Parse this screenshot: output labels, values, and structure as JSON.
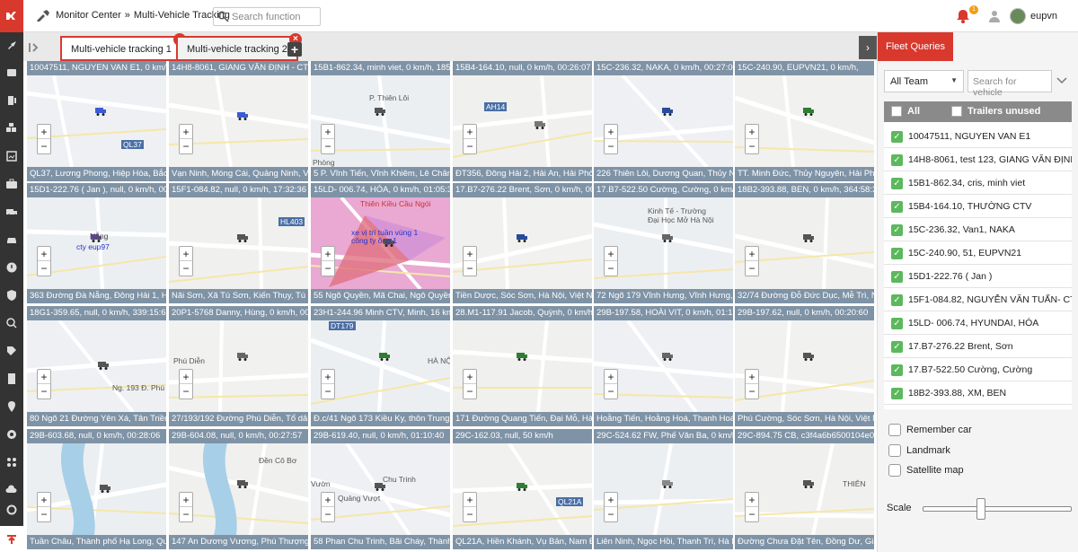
{
  "header": {
    "breadcrumb_root": "Monitor Center",
    "breadcrumb_sep": "»",
    "breadcrumb_page": "Multi-Vehicle Tracking",
    "search_placeholder": "Search function",
    "notification_count": "1",
    "username": "eupvn",
    "accent_color": "#d9382d"
  },
  "tabs": [
    {
      "label": "Multi-vehicle tracking 1"
    },
    {
      "label": "Multi-vehicle tracking 2"
    }
  ],
  "cells": [
    {
      "info": "10047511, NGUYEN VAN E1, 0 km/h, 1",
      "addr": "QL37, Lương Phong, Hiệp Hòa, Bắc Gia"
    },
    {
      "info": "14H8-8061, GIANG VĂN ĐỊNH - CTV Hi",
      "addr": "Vạn Ninh, Móng Cái, Quảng Ninh, Việt N"
    },
    {
      "info": "15B1-862.34, minh viet, 0 km/h, 1852:49",
      "addr": "5 P. Vĩnh Tiến, Vĩnh Khiêm, Lê Chân, Hả"
    },
    {
      "info": "15B4-164.10, null, 0 km/h, 00:26:07",
      "addr": "ĐT356, Đông Hải 2, Hải An, Hải Phòng,"
    },
    {
      "info": "15C-236.32, NAKA, 0 km/h, 00:27:00",
      "addr": "226 Thiên Lôi, Dương Quan, Thủy Nguy"
    },
    {
      "info": "15C-240.90, EUPVN21, 0 km/h,",
      "addr": "TT. Minh Đức, Thủy Nguyên, Hải Phòng"
    },
    {
      "info": "15D1-222.76 ( Jan ), null, 0 km/h, 00:43",
      "addr": "363 Đường Đà Nẵng, Đông Hải 1, Hải A"
    },
    {
      "info": "15F1-084.82, null, 0 km/h, 17:32:36",
      "addr": "Nãi Sơn, Xã Tú Sơn, Kiến Thụy, Tú Sơn"
    },
    {
      "info": "15LD- 006.74, HÓA, 0 km/h, 01:05:30",
      "addr": "55 Ngõ Quyền, Mã Chai, Ngô Quyền, Hả"
    },
    {
      "info": "17.B7-276.22 Brent, Sơn, 0 km/h, 00:30",
      "addr": "Tiền Dược, Sóc Sơn, Hà Nội, Việt Nam"
    },
    {
      "info": "17.B7-522.50 Cường, Cường, 0 km/h,",
      "addr": "72 Ngõ 179 Vĩnh Hưng, Vĩnh Hưng, Ho"
    },
    {
      "info": "18B2-393.88, BEN, 0 km/h, 364:58:39",
      "addr": "32/74 Đường Đỗ Đức Dục, Mễ Trì, Nam"
    },
    {
      "info": "18G1-359.65, null, 0 km/h, 339:15:60",
      "addr": "80 Ngõ 21 Đường Yên Xá, Tân Triều, Th"
    },
    {
      "info": "20P1-5768 Danny, Hùng, 0 km/h, 00:58",
      "addr": "27/193/192 Đường Phú Diễn, Tổ dân phố"
    },
    {
      "info": "23H1-244.96 Minh CTV, Minh, 16 km/h",
      "addr": "Đ.c/41 Ngõ 173 Kiều Ky, thôn Trung Du"
    },
    {
      "info": "28.M1-117.91 Jacob, Quỳnh, 0 km/h,",
      "addr": "171 Đường Quang Tiến, Đại Mỗ, Hà Đô"
    },
    {
      "info": "29B-197.58, HOÀI VIT, 0 km/h, 01:15:57",
      "addr": "Hoằng Tiến, Hoằng Hoá, Thanh Hoá, Việ"
    },
    {
      "info": "29B-197.62, null, 0 km/h, 00:20:60",
      "addr": "Phú Cường, Sóc Sơn, Hà Nội, Việt Nam"
    },
    {
      "info": "29B-603.68, null, 0 km/h, 00:28:06",
      "addr": "Tuần Châu, Thành phố Hạ Long, Quảng"
    },
    {
      "info": "29B-604.08, null, 0 km/h, 00:27:57",
      "addr": "147 An Dương Vương, Phú Thượng, Tây"
    },
    {
      "info": "29B-619.40, null, 0 km/h, 01:10:40",
      "addr": "58 Phan Chu Trinh, Bãi Cháy, Thành phố"
    },
    {
      "info": "29C-162.03, null, 50 km/h",
      "addr": "QL21A, Hiền Khánh, Vụ Bản, Nam Định,"
    },
    {
      "info": "29C-524.62 FW, Phế Văn Ba, 0 km/h,",
      "addr": "Liên Ninh, Ngọc Hồi, Thanh Trì, Hà Nội"
    },
    {
      "info": "29C-894.75 CB, c3f4a6b6500104e0, 0 k",
      "addr": "Đường Chưa Đặt Tên, Đồng Dư, Gia La"
    }
  ],
  "map_labels": {
    "cell1_road": "QL37",
    "cell3_street": "P. Thiên Lôi",
    "cell3_place": "Phòng",
    "cell4_road": "AH14",
    "cell7_a": "Nẵng",
    "cell7_b": "cty eup97",
    "cell8_road": "HL403",
    "cell9_a": "xe vị trí tuần vùng 1",
    "cell9_b": "công ty ông 1",
    "cell9_c": "Thiên Kiều Cầu Ngói",
    "cell11_a": "Kinh Tế - Trường",
    "cell11_b": "Đại Học Mở Hà Nội",
    "cell13_a": "Ng. 193 Đ. Phú Diễn",
    "cell13_b": "Phú Diễn",
    "cell15_road": "DT179",
    "cell15_city": "HÀ NỘI",
    "cell20_a": "Đền Cô Bơ",
    "cell21_a": "Vườn",
    "cell21_b": "Chu Trinh",
    "cell21_c": "Quảng Vượt",
    "cell22_road": "QL21A",
    "cell24_a": "THIÊN"
  },
  "sidebar": {
    "tab_label": "Fleet Queries",
    "team_value": "All Team",
    "vehicle_search_placeholder": "Search for vehicle",
    "all_label": "All",
    "trailers_label": "Trailers unused",
    "vehicles": [
      "10047511, NGUYEN VAN E1",
      "14H8-8061, test 123, GIANG VĂN ĐỊNH - CTV Hi",
      "15B1-862.34, cris, minh viet",
      "15B4-164.10, THƯỜNG CTV",
      "15C-236.32, Van1, NAKA",
      "15C-240.90, 51, EUPVN21",
      "15D1-222.76 ( Jan )",
      "15F1-084.82, NGUYỄN VĂN TUẤN- CTV",
      "15LD- 006.74, HYUNDAI, HÓA",
      "17.B7-276.22 Brent, Sơn",
      "17.B7-522.50 Cường, Cường",
      "18B2-393.88, XM, BEN"
    ],
    "options": [
      "Remember car",
      "Landmark",
      "Satellite map"
    ],
    "scale_label": "Scale",
    "scale_value": 0.38
  }
}
